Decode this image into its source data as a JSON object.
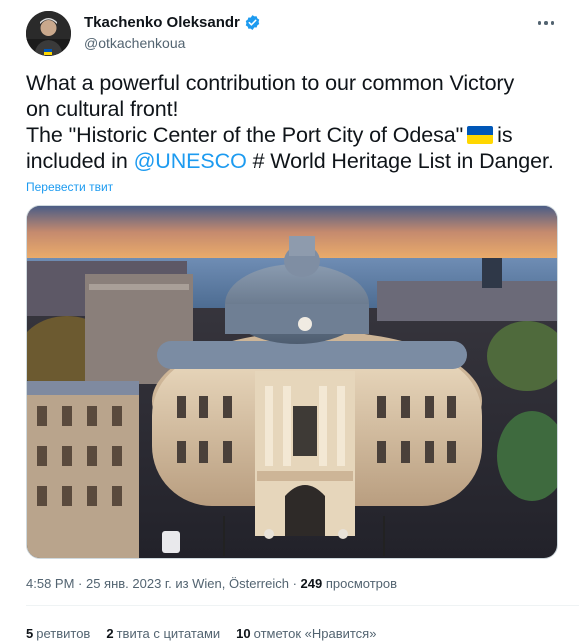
{
  "author": {
    "display_name": "Tkachenko Oleksandr",
    "handle": "@otkachenkoua",
    "verified": true
  },
  "tweet": {
    "line1": "What a powerful contribution to our common Victory",
    "line2": "on cultural front!",
    "line3_before_flag": "The \"Historic Center of the Port City of Odesa\"",
    "line3_after_flag": "is",
    "line4_prefix": "included in ",
    "mention": "@UNESCO",
    "line4_suffix": " # World Heritage List in Danger.",
    "flag_icon": "ukraine-flag-icon"
  },
  "translate_label": "Перевести твит",
  "meta": {
    "time": "4:58 PM",
    "sep1": " · ",
    "date": "25 янв. 2023 г.",
    "location": " из Wien, Österreich",
    "sep2": " · ",
    "views_count": "249",
    "views_label": " просмотров"
  },
  "stats": {
    "retweets_count": "5",
    "retweets_label": "ретвитов",
    "quotes_count": "2",
    "quotes_label": "твита с цитатами",
    "likes_count": "10",
    "likes_label": "отметок «Нравится»"
  },
  "colors": {
    "accent": "#1d9bf0",
    "text": "#0f1419",
    "secondary": "#536471",
    "flag_blue": "#0057b7",
    "flag_yellow": "#ffd700"
  }
}
